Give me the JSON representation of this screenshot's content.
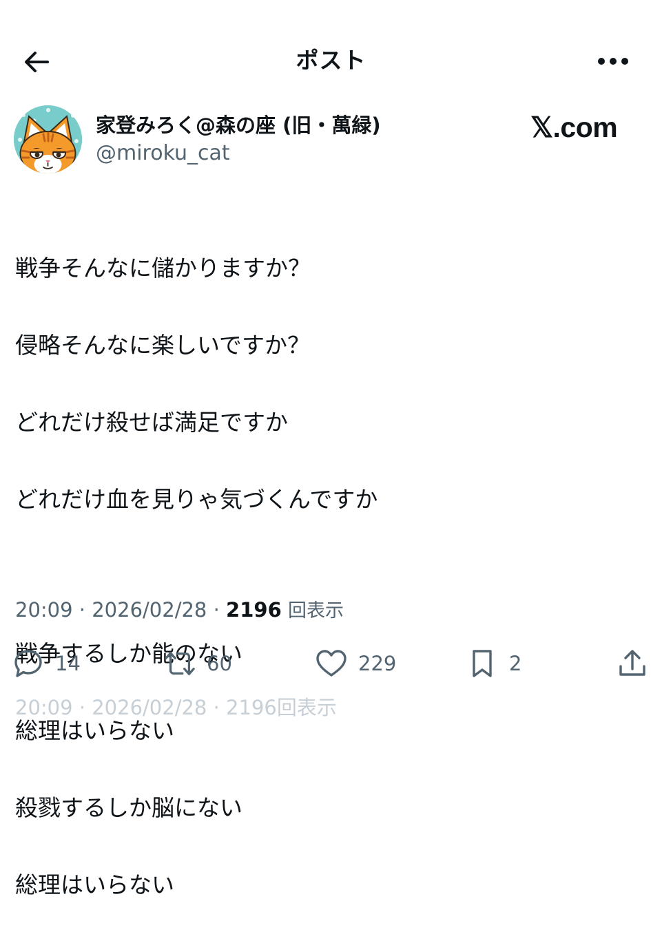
{
  "header": {
    "title": "ポスト",
    "back_icon": "arrow-left-icon",
    "more_icon": "more-horizontal-icon"
  },
  "author": {
    "display_name": "家登みろく@森の座 (旧・萬緑)",
    "handle": "@miroku_cat",
    "avatar": "orange-cat-avatar"
  },
  "brand": {
    "label": "𝕏.com"
  },
  "post": {
    "lines": [
      "戦争そんなに儲かりますか？",
      "侵略そんなに楽しいですか？",
      "どれだけ殺せば満足ですか",
      "どれだけ血を見りゃ気づくんですか",
      "",
      "戦争するしか能のない",
      "総理はいらない",
      "殺戮するしか脳にない",
      "総理はいらない"
    ]
  },
  "meta": {
    "time": "20:09",
    "separator": " · ",
    "date": "2026/02/28",
    "views_count": "2196",
    "views_label": "回表示"
  },
  "actions": {
    "replies": {
      "icon": "reply-icon",
      "count": "14"
    },
    "reposts": {
      "icon": "repost-icon",
      "count": "60"
    },
    "likes": {
      "icon": "heart-icon",
      "count": "229"
    },
    "bookmarks": {
      "icon": "bookmark-icon",
      "count": "2"
    },
    "share": {
      "icon": "share-icon"
    }
  },
  "colors": {
    "text": "#0f1419",
    "secondary": "#536471",
    "avatar_bg": "#78ccc9",
    "cat_orange": "#f39a2b"
  }
}
